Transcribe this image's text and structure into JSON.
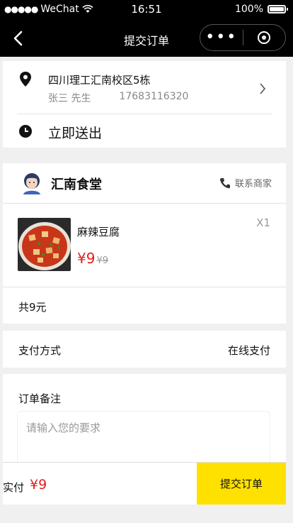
{
  "status_bar": {
    "carrier": "WeChat",
    "signal_dots": "●●●●●",
    "time": "16:51",
    "battery": "100%"
  },
  "nav": {
    "title": "提交订单"
  },
  "address": {
    "line": "四川理工汇南校区5栋",
    "name": "张三 先生",
    "phone": "17683116320",
    "delivery_time": "立即送出"
  },
  "shop": {
    "name": "汇南食堂",
    "contact_label": "联系商家"
  },
  "items": [
    {
      "name": "麻辣豆腐",
      "quantity": "X1",
      "price": "¥9",
      "original_price": "¥9"
    }
  ],
  "summary": {
    "total": "共9元"
  },
  "payment": {
    "label": "支付方式",
    "method": "在线支付"
  },
  "note": {
    "label": "订单备注",
    "placeholder": "请输入您的要求"
  },
  "bottom": {
    "paid_label": "实付",
    "paid_amount": "¥9",
    "submit_label": "提交订单"
  },
  "colors": {
    "accent_red": "#e02020",
    "submit_yellow": "#ffe100",
    "nav_black": "#000000"
  }
}
